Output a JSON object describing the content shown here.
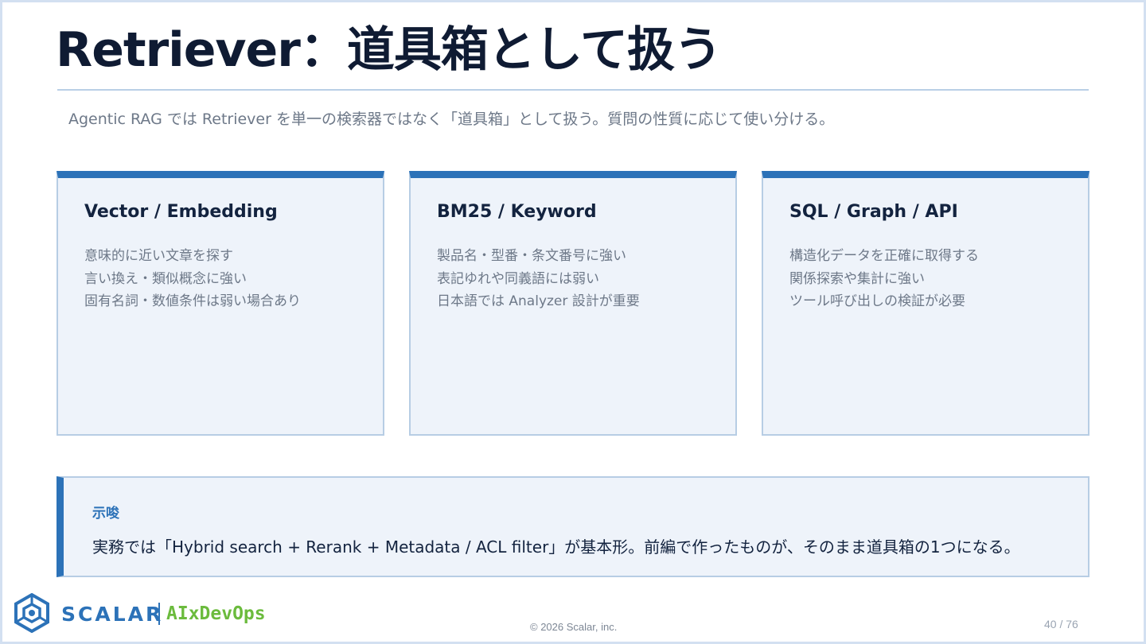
{
  "slide": {
    "title": "Retriever：道具箱として扱う",
    "subtitle": "Agentic RAG では Retriever を単一の検索器ではなく「道具箱」として扱う。質問の性質に応じて使い分ける。"
  },
  "cards": [
    {
      "title": "Vector / Embedding",
      "lines": [
        "意味的に近い文章を探す",
        "言い換え・類似概念に強い",
        "固有名詞・数値条件は弱い場合あり"
      ]
    },
    {
      "title": "BM25 / Keyword",
      "lines": [
        "製品名・型番・条文番号に強い",
        "表記ゆれや同義語には弱い",
        "日本語では Analyzer 設計が重要"
      ]
    },
    {
      "title": "SQL / Graph / API",
      "lines": [
        "構造化データを正確に取得する",
        "関係探索や集計に強い",
        "ツール呼び出しの検証が必要"
      ]
    }
  ],
  "callout": {
    "label": "示唆",
    "text": "実務では「Hybrid search + Rerank + Metadata / ACL filter」が基本形。前編で作ったものが、そのまま道具箱の1つになる。"
  },
  "footer": {
    "brand": "SCALAR",
    "brand_sub": "AIxDevOps",
    "copyright": "© 2026 Scalar, inc.",
    "page": "40 / 76"
  },
  "colors": {
    "accent": "#2c72b8",
    "card_bg": "#eef3fa",
    "border": "#b7cde4",
    "title": "#0f1b33",
    "muted": "#6d7888",
    "brand_green": "#6bbb3d"
  },
  "icons": {
    "logo": "scalar-logo-icon"
  }
}
